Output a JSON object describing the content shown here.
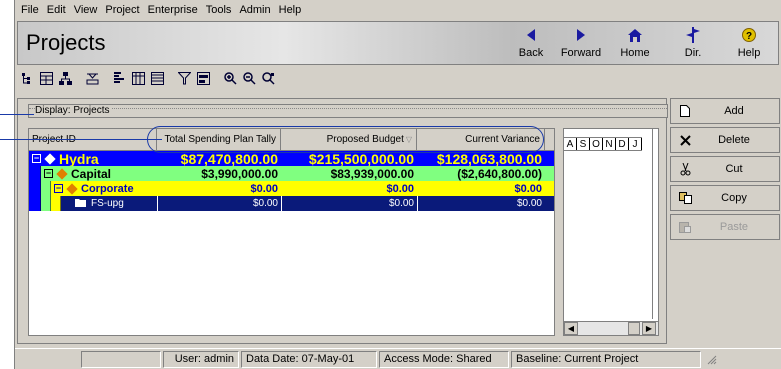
{
  "menu": [
    "File",
    "Edit",
    "View",
    "Project",
    "Enterprise",
    "Tools",
    "Admin",
    "Help"
  ],
  "header": {
    "title": "Projects",
    "nav": [
      {
        "label": "Back",
        "icon": "back-arrow-icon"
      },
      {
        "label": "Forward",
        "icon": "forward-arrow-icon"
      },
      {
        "label": "Home",
        "icon": "home-icon"
      },
      {
        "label": "Dir.",
        "icon": "directory-icon"
      },
      {
        "label": "Help",
        "icon": "help-icon"
      }
    ]
  },
  "display_bar": "Display: Projects",
  "grid": {
    "columns": [
      "Project ID",
      "Total Spending Plan Tally",
      "Proposed Budget",
      "Current Variance"
    ],
    "rows": [
      {
        "id": "Hydra",
        "tally": "$87,470,800.00",
        "budget": "$215,500,000.00",
        "variance": "$128,063,800.00"
      },
      {
        "id": "Capital",
        "tally": "$3,990,000.00",
        "budget": "$83,939,000.00",
        "variance": "($2,640,800.00)"
      },
      {
        "id": "Corporate",
        "tally": "$0.00",
        "budget": "$0.00",
        "variance": "$0.00"
      },
      {
        "id": "FS-upg",
        "tally": "$0.00",
        "budget": "$0.00",
        "variance": "$0.00"
      }
    ]
  },
  "gantt": {
    "months": [
      "A",
      "S",
      "O",
      "N",
      "D",
      "J"
    ]
  },
  "actions": [
    {
      "label": "Add",
      "icon": "add-page-icon",
      "enabled": true
    },
    {
      "label": "Delete",
      "icon": "delete-x-icon",
      "enabled": true
    },
    {
      "label": "Cut",
      "icon": "scissors-icon",
      "enabled": true
    },
    {
      "label": "Copy",
      "icon": "copy-icon",
      "enabled": true
    },
    {
      "label": "Paste",
      "icon": "paste-icon",
      "enabled": false
    }
  ],
  "status": {
    "user": "User: admin",
    "data_date": "Data Date: 07-May-01",
    "access_mode": "Access Mode: Shared",
    "baseline": "Baseline: Current Project"
  },
  "colors": {
    "hydra_bg": "#0000ff",
    "hydra_text": "#ffff00",
    "capital_bg": "#80ff80",
    "corporate_bg": "#ffff00",
    "corporate_text": "#0000c0",
    "fs_bg": "#0a1a7a",
    "callout": "#1a3aa8"
  }
}
